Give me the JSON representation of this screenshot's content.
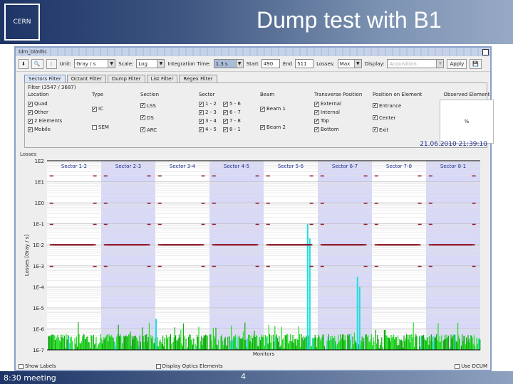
{
  "slide": {
    "title": "Dump test with B1",
    "logo_text": "CERN",
    "footer_left": "8:30 meeting",
    "page_number": "4"
  },
  "window": {
    "title": "blm_blmlhc"
  },
  "toolbar": {
    "unit_label": "Unit:",
    "unit_value": "Gray / s",
    "scale_label": "Scale:",
    "scale_value": "Log",
    "integration_label": "Integration Time:",
    "integration_value": "1.3 s",
    "start_label": "Start",
    "start_value": "490",
    "end_label": "End",
    "end_value": "511",
    "losses_label": "Losses:",
    "losses_value": "Max",
    "display_label": "Display:",
    "display_value": "Acquisition",
    "apply_label": "Apply"
  },
  "tabs": [
    "Sectors Filter",
    "Octant Filter",
    "Dump Filter",
    "List Filter",
    "Regex Filter"
  ],
  "filter": {
    "title": "Filter (3547 / 3687)",
    "groups": [
      {
        "h": "Location",
        "items": [
          "Quad",
          "Other",
          "2 Elements",
          "Mobile"
        ],
        "checked": [
          true,
          true,
          true,
          true
        ]
      },
      {
        "h": "Type",
        "items": [
          "IC",
          "SEM"
        ],
        "checked": [
          true,
          false
        ]
      },
      {
        "h": "Section",
        "items": [
          "LSS",
          "DS",
          "ARC"
        ],
        "checked": [
          true,
          true,
          true
        ]
      },
      {
        "h": "Sector",
        "items": [
          "1 - 2",
          "2 - 3",
          "3 - 4",
          "4 - 5",
          "5 - 6",
          "6 - 7",
          "7 - 8",
          "8 - 1"
        ],
        "checked": [
          true,
          true,
          true,
          true,
          true,
          true,
          true,
          true
        ]
      },
      {
        "h": "Beam",
        "items": [
          "Beam 1",
          "Beam 2"
        ],
        "checked": [
          true,
          true
        ]
      },
      {
        "h": "Transverse Position",
        "items": [
          "External",
          "Internal",
          "Top",
          "Bottom"
        ],
        "checked": [
          true,
          true,
          true,
          true
        ]
      },
      {
        "h": "Position on Element",
        "items": [
          "Entrance",
          "Center",
          "Exit"
        ],
        "checked": [
          true,
          true,
          true
        ]
      }
    ],
    "observed_title": "Observed Element",
    "observed_value": "%"
  },
  "timestamp": "21.06.2010 21:39:10",
  "bottom": {
    "show_labels": "Show Labels",
    "display_optics": "Display Optics Elements",
    "use_dcum": "Use DCUM"
  },
  "colors": {
    "band": "#d8d8f8",
    "bar": "#22dd22",
    "bar_dark": "#11aa11",
    "cyan": "#22dddd",
    "threshold": "#8b1020"
  },
  "chart_data": {
    "type": "bar",
    "title": "Losses",
    "ylabel": "Losses [Gray / s]",
    "xlabel": "Monitors",
    "yscale": "log",
    "ylim": [
      1e-07,
      100
    ],
    "yticks": [
      "1E2",
      "1E1",
      "1E0",
      "1E-1",
      "1E-2",
      "1E-3",
      "1E-4",
      "1E-5",
      "1E-6",
      "1E-7"
    ],
    "sectors": [
      "Sector 1-2",
      "Sector 2-3",
      "Sector 3-4",
      "Sector 4-5",
      "Sector 5-6",
      "Sector 6-7",
      "Sector 7-8",
      "Sector 8-1"
    ],
    "shaded_sectors": [
      1,
      3,
      5,
      7
    ],
    "typical_loss": 3e-07,
    "threshold_level": 0.01,
    "spikes": [
      {
        "monitor_fraction": 0.6,
        "value": 0.1
      },
      {
        "monitor_fraction": 0.605,
        "value": 0.02
      },
      {
        "monitor_fraction": 0.72,
        "value": 0.0001
      },
      {
        "monitor_fraction": 0.715,
        "value": 0.0003
      },
      {
        "monitor_fraction": 0.25,
        "value": 3e-06
      }
    ]
  }
}
